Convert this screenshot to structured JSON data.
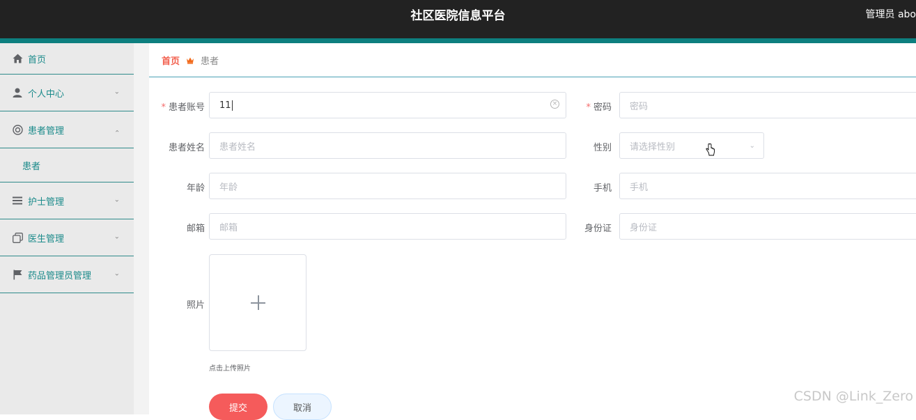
{
  "header": {
    "title": "社区医院信息平台",
    "user": "管理员 abo"
  },
  "sidebar": {
    "items": [
      {
        "label": "首页",
        "icon": "home-icon"
      },
      {
        "label": "个人中心",
        "icon": "person-icon"
      },
      {
        "label": "患者管理",
        "icon": "lifebuoy-icon",
        "sub": [
          "患者"
        ]
      },
      {
        "label": "护士管理",
        "icon": "list-icon"
      },
      {
        "label": "医生管理",
        "icon": "copy-icon"
      },
      {
        "label": "药品管理员管理",
        "icon": "flag-icon"
      }
    ]
  },
  "breadcrumb": {
    "home": "首页",
    "current": "患者"
  },
  "form": {
    "account": {
      "label": "患者账号",
      "value": "11"
    },
    "password": {
      "label": "密码",
      "placeholder": "密码"
    },
    "name": {
      "label": "患者姓名",
      "placeholder": "患者姓名"
    },
    "gender": {
      "label": "性别",
      "placeholder": "请选择性别"
    },
    "age": {
      "label": "年龄",
      "placeholder": "年龄"
    },
    "phone": {
      "label": "手机",
      "placeholder": "手机"
    },
    "email": {
      "label": "邮箱",
      "placeholder": "邮箱"
    },
    "idcard": {
      "label": "身份证",
      "placeholder": "身份证"
    },
    "photo": {
      "label": "照片",
      "hint": "点击上传照片"
    },
    "required_mark": "*",
    "submit": "提交",
    "cancel": "取消"
  },
  "watermark": "CSDN @Link_Zero",
  "colors": {
    "topbar": "#222222",
    "accent": "#0d7f7f",
    "menu_text": "#1a8a8a",
    "submit": "#f55b5b",
    "crumb_home": "#f25e4c"
  }
}
